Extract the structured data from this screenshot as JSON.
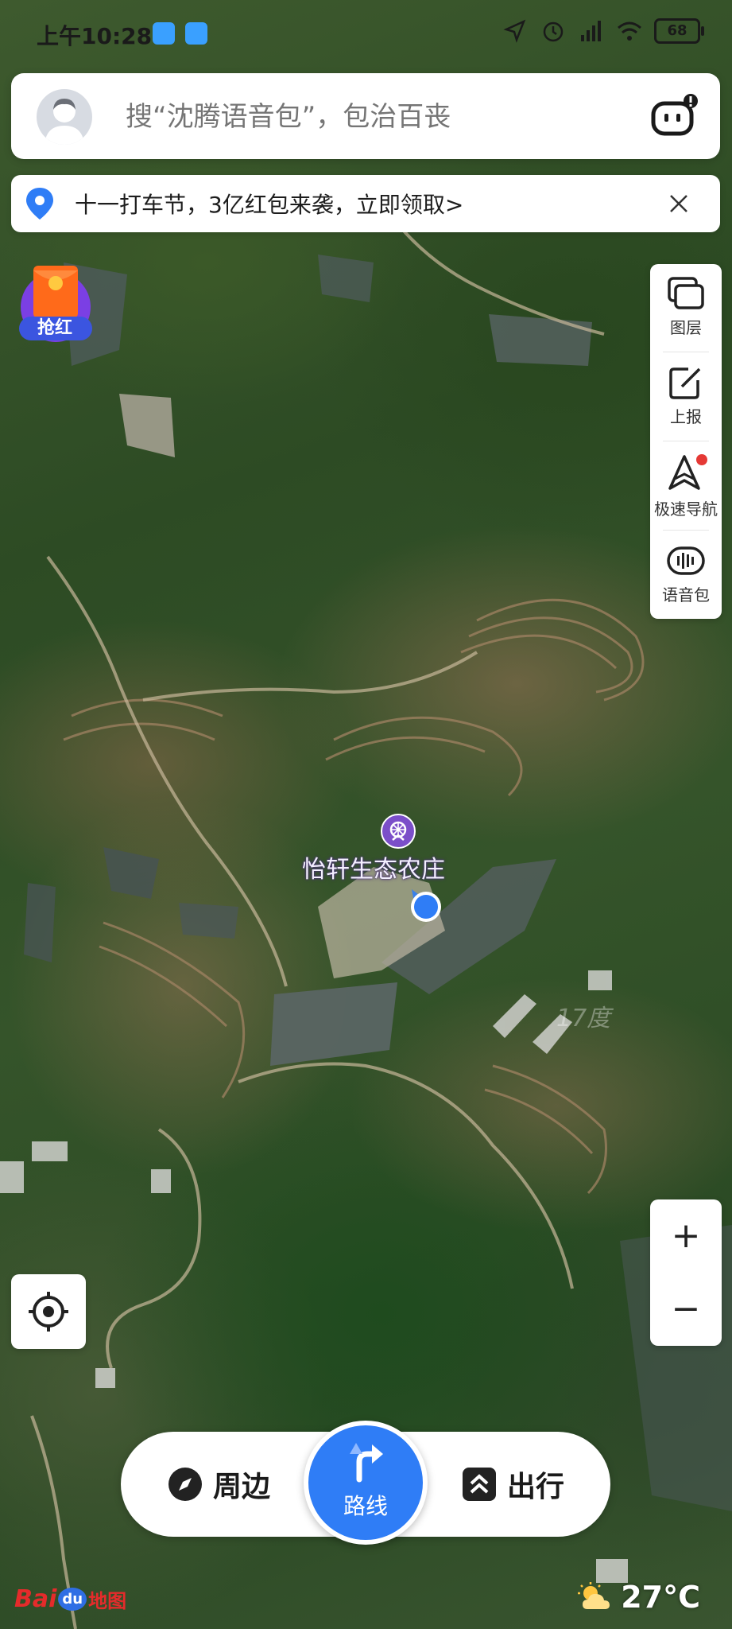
{
  "status_bar": {
    "time": "上午10:28",
    "battery": "68"
  },
  "search": {
    "placeholder": "搜“沈腾语音包”，包治百丧"
  },
  "promo": {
    "text": "十一打车节，3亿红包来袭，立即领取>"
  },
  "red_packet": {
    "label": "抢红"
  },
  "tools": [
    {
      "label": "图层",
      "icon": "layers-icon"
    },
    {
      "label": "上报",
      "icon": "report-edit-icon"
    },
    {
      "label": "极速导航",
      "icon": "fast-navigation-icon"
    },
    {
      "label": "语音包",
      "icon": "voice-pack-icon"
    }
  ],
  "map": {
    "poi_name": "怡轩生态农庄",
    "watermark": "17度"
  },
  "zoom": {
    "in": "+",
    "out": "−"
  },
  "bottom_bar": {
    "nearby": "周边",
    "route": "路线",
    "travel": "出行"
  },
  "footer": {
    "logo_bai": "Bai",
    "logo_du": "du",
    "logo_map": "地图",
    "temperature": "27°C"
  },
  "colors": {
    "accent_blue": "#2f7df6",
    "poi_purple": "#7b4fc9",
    "notification_red": "#e53935"
  }
}
